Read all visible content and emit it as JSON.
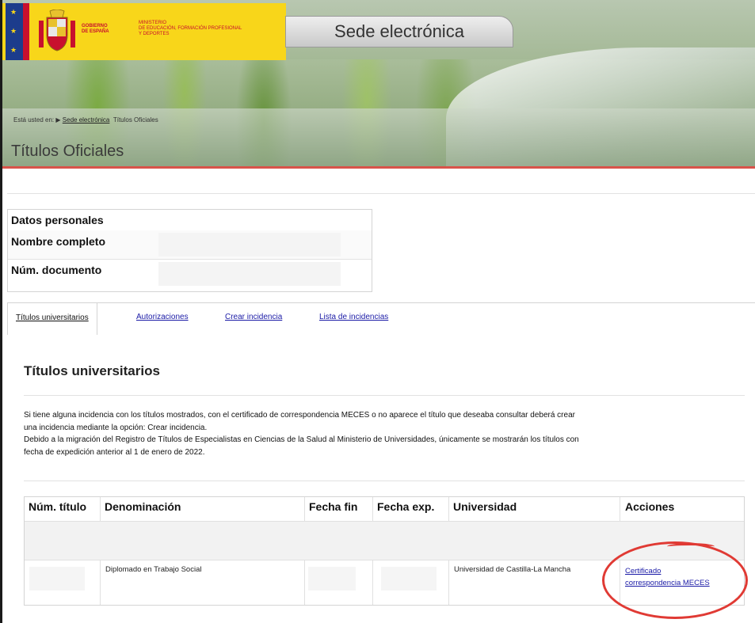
{
  "header": {
    "gov_line1": "GOBIERNO",
    "gov_line2": "DE ESPAÑA",
    "ministry_line1": "MINISTERIO",
    "ministry_line2": "DE EDUCACIÓN, FORMACIÓN PROFESIONAL",
    "ministry_line3": "Y DEPORTES",
    "sede_tab": "Sede electrónica",
    "breadcrumb_prefix": "Está usted en:",
    "breadcrumb_link": "Sede electrónica",
    "breadcrumb_current": "Títulos Oficiales",
    "page_title": "Títulos Oficiales"
  },
  "personal": {
    "heading": "Datos personales",
    "name_label": "Nombre completo",
    "doc_label": "Núm. documento"
  },
  "tabs": [
    {
      "label": "Títulos universitarios",
      "active": true
    },
    {
      "label": "Autorizaciones",
      "active": false
    },
    {
      "label": "Crear incidencia",
      "active": false
    },
    {
      "label": "Lista de incidencias",
      "active": false
    }
  ],
  "section": {
    "title": "Títulos universitarios",
    "notice_line1": "Si tiene alguna incidencia con los títulos mostrados, con el certificado de correspondencia MECES o no aparece el título que deseaba consultar deberá crear",
    "notice_line2": "una incidencia mediante la opción: Crear incidencia.",
    "notice_line3": "Debido a la migración del Registro de Títulos de Especialistas en Ciencias de la Salud al Ministerio de Universidades, únicamente se mostrarán los títulos con",
    "notice_line4": "fecha de expedición anterior al 1 de enero de 2022."
  },
  "table": {
    "headers": [
      "Núm. título",
      "Denominación",
      "Fecha fin",
      "Fecha exp.",
      "Universidad",
      "Acciones"
    ],
    "row": {
      "denominacion": "Diplomado en Trabajo Social",
      "universidad": "Universidad de Castilla-La Mancha",
      "action_line1": "Certificado",
      "action_line2": "correspondencia MECES"
    }
  },
  "colors": {
    "accent_red": "#d9534a",
    "logo_yellow": "#f8d61a",
    "link_blue": "#1a1aa6",
    "annotation_red": "#e03a34"
  },
  "icons": [
    "spain-flag-icon",
    "coat-of-arms-icon",
    "breadcrumb-arrow-icon"
  ]
}
